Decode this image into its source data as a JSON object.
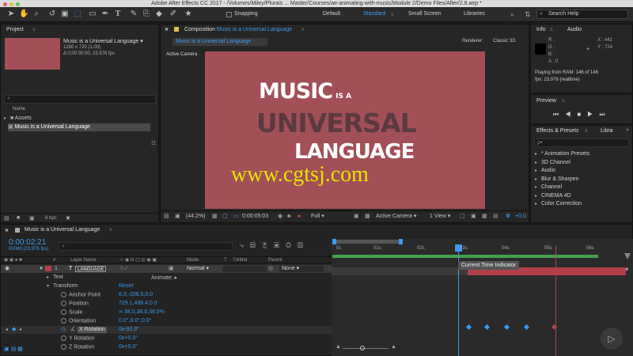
{
  "window": {
    "title": "Adobe After Effects CC 2017 - /Volumes/Miley/Plurais ... Master/Courses/ae-animating-with-music/Module 2/Demo Files/After/2.8.aep *"
  },
  "toolbar": {
    "snapping": "Snapping",
    "workspaces": [
      "Default",
      "Standard",
      "Small Screen",
      "Libraries"
    ],
    "search_placeholder": "Search Help"
  },
  "project": {
    "title": "Project",
    "comp_name": "Music is a Universal Language",
    "comp_size": "1280 x 720 (1.00)",
    "comp_duration": "Δ 0;00:30:00, 23.976 fps",
    "col_name": "Name",
    "items": [
      "Assets",
      "Music is a Universal Language"
    ],
    "bpc": "8 bpc"
  },
  "composition": {
    "label": "Composition",
    "name": "Music is a Universal Language",
    "tab": "Music is a Universal Language",
    "renderer_label": "Renderer:",
    "renderer": "Classic 3D",
    "active_camera": "Active Camera",
    "line1_big": "MUSIC",
    "line1_small": "IS A",
    "line2": "UNIVERSAL",
    "line3": "LANGUAGE",
    "watermark": "www.cgtsj.com",
    "zoom": "(44.2%)",
    "time": "0:00:05:03",
    "resolution": "Full",
    "camera": "Active Camera",
    "view": "1 View",
    "offset": "+0.0"
  },
  "info": {
    "tabs": [
      "Info",
      "Audio"
    ],
    "r": "R :",
    "g": "G :",
    "b": "B :",
    "a": "A : 0",
    "x": "X : 441",
    "y": "Y : 724",
    "ram": "Playing from RAM: 146 of 146",
    "fps": "fps: 23.976 (realtime)"
  },
  "preview": {
    "title": "Preview"
  },
  "effects": {
    "tabs": [
      "Effects & Presets",
      "Libra"
    ],
    "search_placeholder": "ρ•",
    "items": [
      "* Animation Presets",
      "3D Channel",
      "Audio",
      "Blur & Sharpen",
      "Channel",
      "CINEMA 4D",
      "Color Correction"
    ]
  },
  "timeline": {
    "tab": "Music is a Universal Language",
    "timecode": "0:00:02:21",
    "frames": "00069 (23.976 fps)",
    "cols": {
      "num": "#",
      "layer": "Layer Name",
      "mode": "Mode",
      "t": "T",
      "trkmat": "TrkMat",
      "parent": "Parent"
    },
    "layer": {
      "num": "1",
      "name": "LANGUAGE",
      "mode": "Normal",
      "parent": "None"
    },
    "text": "Text",
    "animate": "Animate:",
    "transform": "Transform",
    "reset": "Reset",
    "props": [
      {
        "name": "Anchor Point",
        "value": "6.0,-208.5,0.0"
      },
      {
        "name": "Position",
        "value": "729.1,436.4,0.0"
      },
      {
        "name": "Scale",
        "value": "∞ 38.0,38.0,38.0%"
      },
      {
        "name": "Orientation",
        "value": "0.0°,0.0°,0.0°"
      },
      {
        "name": "X Rotation",
        "value": "0x-92.0°"
      },
      {
        "name": "Y Rotation",
        "value": "0x+0.0°"
      },
      {
        "name": "Z Rotation",
        "value": "0x+0.0°"
      }
    ],
    "ticks": [
      "0s",
      "01s",
      "02s",
      "03s",
      "04s",
      "05s",
      "06s"
    ],
    "tooltip": "Current Time Indicator"
  },
  "colors": {
    "accent": "#3a9bf0",
    "comp_bg": "#a24f57",
    "layer_bar": "#b2404a",
    "work_area": "#43a14c"
  }
}
